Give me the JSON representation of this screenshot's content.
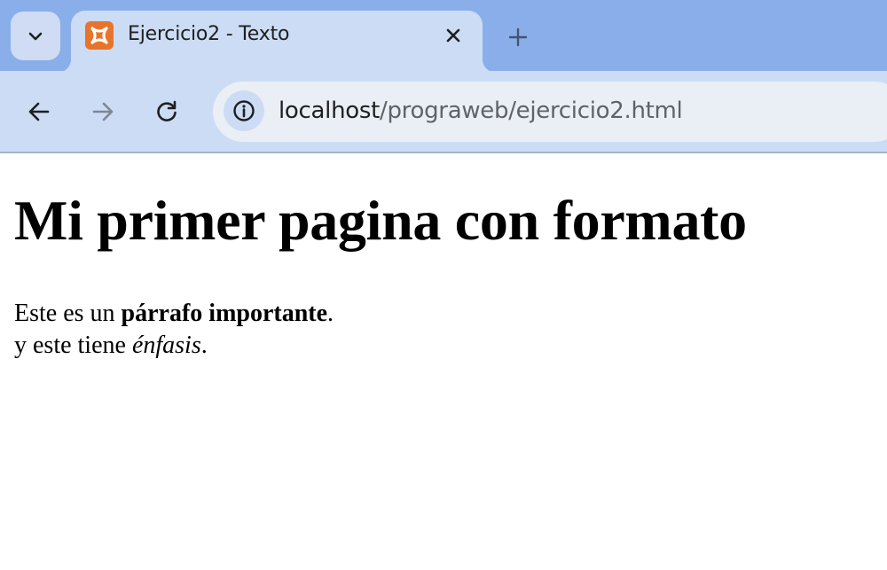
{
  "tab": {
    "title": "Ejercicio2 - Texto",
    "favicon": "xampp-icon"
  },
  "toolbar": {
    "url_host": "localhost",
    "url_path": "/prograweb/ejercicio2.html"
  },
  "page": {
    "heading": "Mi primer pagina con formato",
    "line1_start": "Este es un ",
    "line1_bold": "párrafo importante",
    "line1_end": ".",
    "line2_start": "y este tiene ",
    "line2_italic": "énfasis",
    "line2_end": "."
  },
  "colors": {
    "tabstrip_bg": "#8aaeea",
    "active_tab_bg": "#ccdcf4",
    "omnibox_bg": "#eaeff6",
    "favicon_bg": "#e8742b"
  }
}
